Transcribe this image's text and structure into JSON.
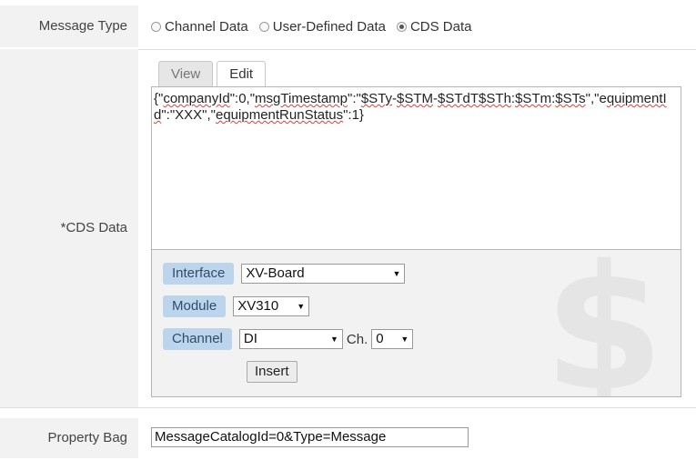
{
  "message_type": {
    "label": "Message Type",
    "options": [
      {
        "label": "Channel Data",
        "selected": false
      },
      {
        "label": "User-Defined Data",
        "selected": false
      },
      {
        "label": "CDS Data",
        "selected": true
      }
    ]
  },
  "cds_data": {
    "label": "*CDS Data",
    "tabs": [
      {
        "label": "View",
        "active": false
      },
      {
        "label": "Edit",
        "active": true
      }
    ],
    "editor_text": {
      "p1": "{\"",
      "w1": "companyId",
      "p2": "\":0,\"",
      "w2": "msgTimestamp",
      "p3": "\":\"",
      "w3": "$STy",
      "p4": "-",
      "w4": "$STM",
      "p5": "-",
      "w5": "$STdT$STh",
      "p6": ":",
      "w6": "$STm",
      "p7": ":",
      "w7": "$STs",
      "p8": "\",\"e",
      "w8": "quipmentId",
      "p9": "\":\"XXX\",\"",
      "w9": "equipmentRunStatus",
      "p10": "\":1}"
    },
    "panel": {
      "decor_symbol": "$",
      "interface": {
        "label": "Interface",
        "value": "XV-Board"
      },
      "module": {
        "label": "Module",
        "value": "XV310"
      },
      "channel": {
        "label": "Channel",
        "value": "DI",
        "ch_label": "Ch.",
        "ch_value": "0"
      },
      "insert_label": "Insert"
    }
  },
  "property_bag": {
    "label": "Property Bag",
    "value": "MessageCatalogId=0&Type=Message"
  }
}
